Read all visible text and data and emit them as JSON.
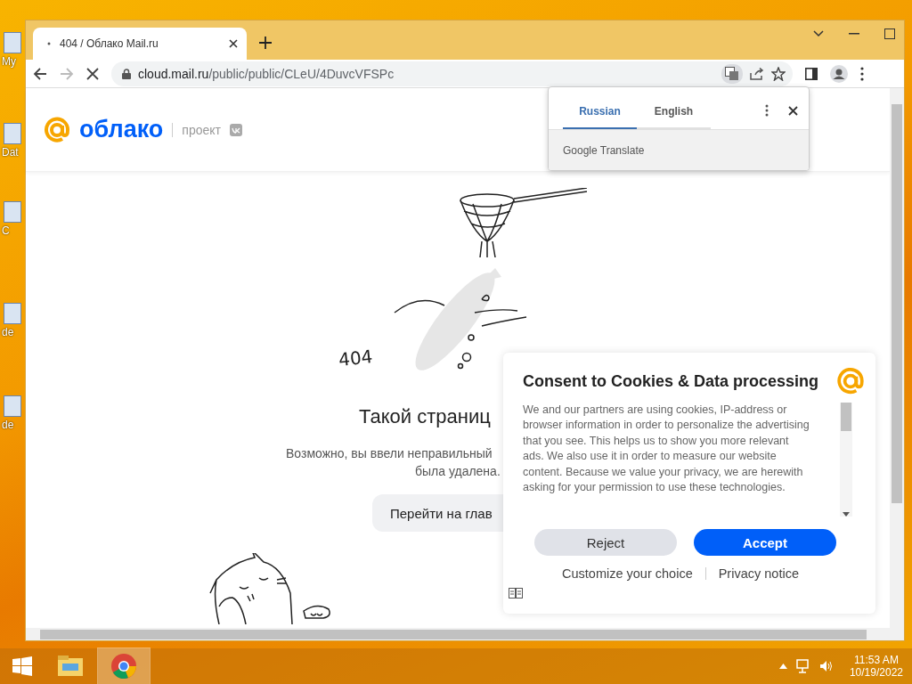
{
  "desktop": {
    "icons": [
      {
        "label": "My"
      },
      {
        "label": "Dat"
      },
      {
        "label": "C"
      },
      {
        "label": "de"
      },
      {
        "label": "de"
      }
    ]
  },
  "browser": {
    "tabs": [
      {
        "title": "404 / Облако Mail.ru",
        "selected": true,
        "loading": true
      }
    ],
    "nav": {
      "back_disabled": false,
      "forward_disabled": true,
      "loading": true
    },
    "address": {
      "host": "cloud.mail.ru",
      "path": "/public/public/CLeU/4DuvcVFSPc"
    }
  },
  "translate_popup": {
    "tabs": [
      {
        "label": "Russian",
        "selected": true
      },
      {
        "label": "English",
        "selected": false
      }
    ],
    "footer": "Google Translate"
  },
  "page": {
    "logo": "облако",
    "project": "проект",
    "error_code": "404",
    "heading": "Такой страниц",
    "description_lines": [
      "Возможно, вы ввели неправильный",
      "была удалена."
    ],
    "home_button": "Перейти на глав"
  },
  "cookie_dialog": {
    "title": "Consent to Cookies & Data processing",
    "body": "We and our partners are using cookies, IP-address or browser information in order to personalize the advertising that you see. This helps us to show you more relevant ads. We also use it in order to measure our website content. Because we value your privacy, we are herewith asking for your permission to use these technologies.",
    "buttons": [
      {
        "label": "Reject",
        "kind": "secondary"
      },
      {
        "label": "Accept",
        "kind": "primary"
      }
    ],
    "links": [
      "Customize your choice",
      "Privacy notice"
    ]
  },
  "taskbar": {
    "apps": [
      {
        "kind": "explorer",
        "selected": false
      },
      {
        "kind": "chrome",
        "selected": true
      }
    ],
    "clock": {
      "time": "11:53 AM",
      "date": "10/19/2022"
    }
  }
}
